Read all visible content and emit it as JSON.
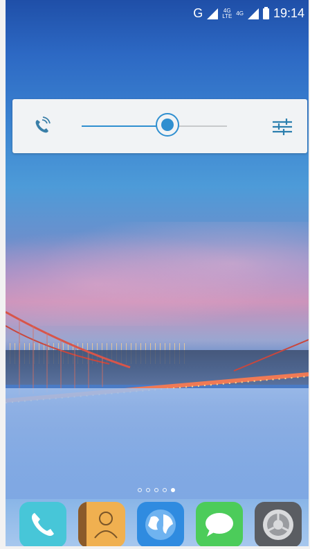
{
  "status_bar": {
    "network_type": "G",
    "lte_label_top": "4G",
    "lte_label_bottom": "LTE",
    "lte2_label": "4G",
    "time": "19:14"
  },
  "volume_panel": {
    "stream_icon": "phone-volume-icon",
    "settings_icon": "equalizer-icon",
    "level_fraction": 0.59,
    "accent_color": "#2f8fd0"
  },
  "home": {
    "page_count": 5,
    "active_page_index": 4
  },
  "dock": {
    "apps": [
      {
        "icon": "phone-app-icon",
        "color": "#47c6d8"
      },
      {
        "icon": "contacts-app-icon",
        "color": "#f0b050"
      },
      {
        "icon": "browser-app-icon",
        "color": "#2f8be0"
      },
      {
        "icon": "messaging-app-icon",
        "color": "#4ccc5a"
      },
      {
        "icon": "settings-app-icon",
        "color": "#5a5d62"
      }
    ]
  }
}
